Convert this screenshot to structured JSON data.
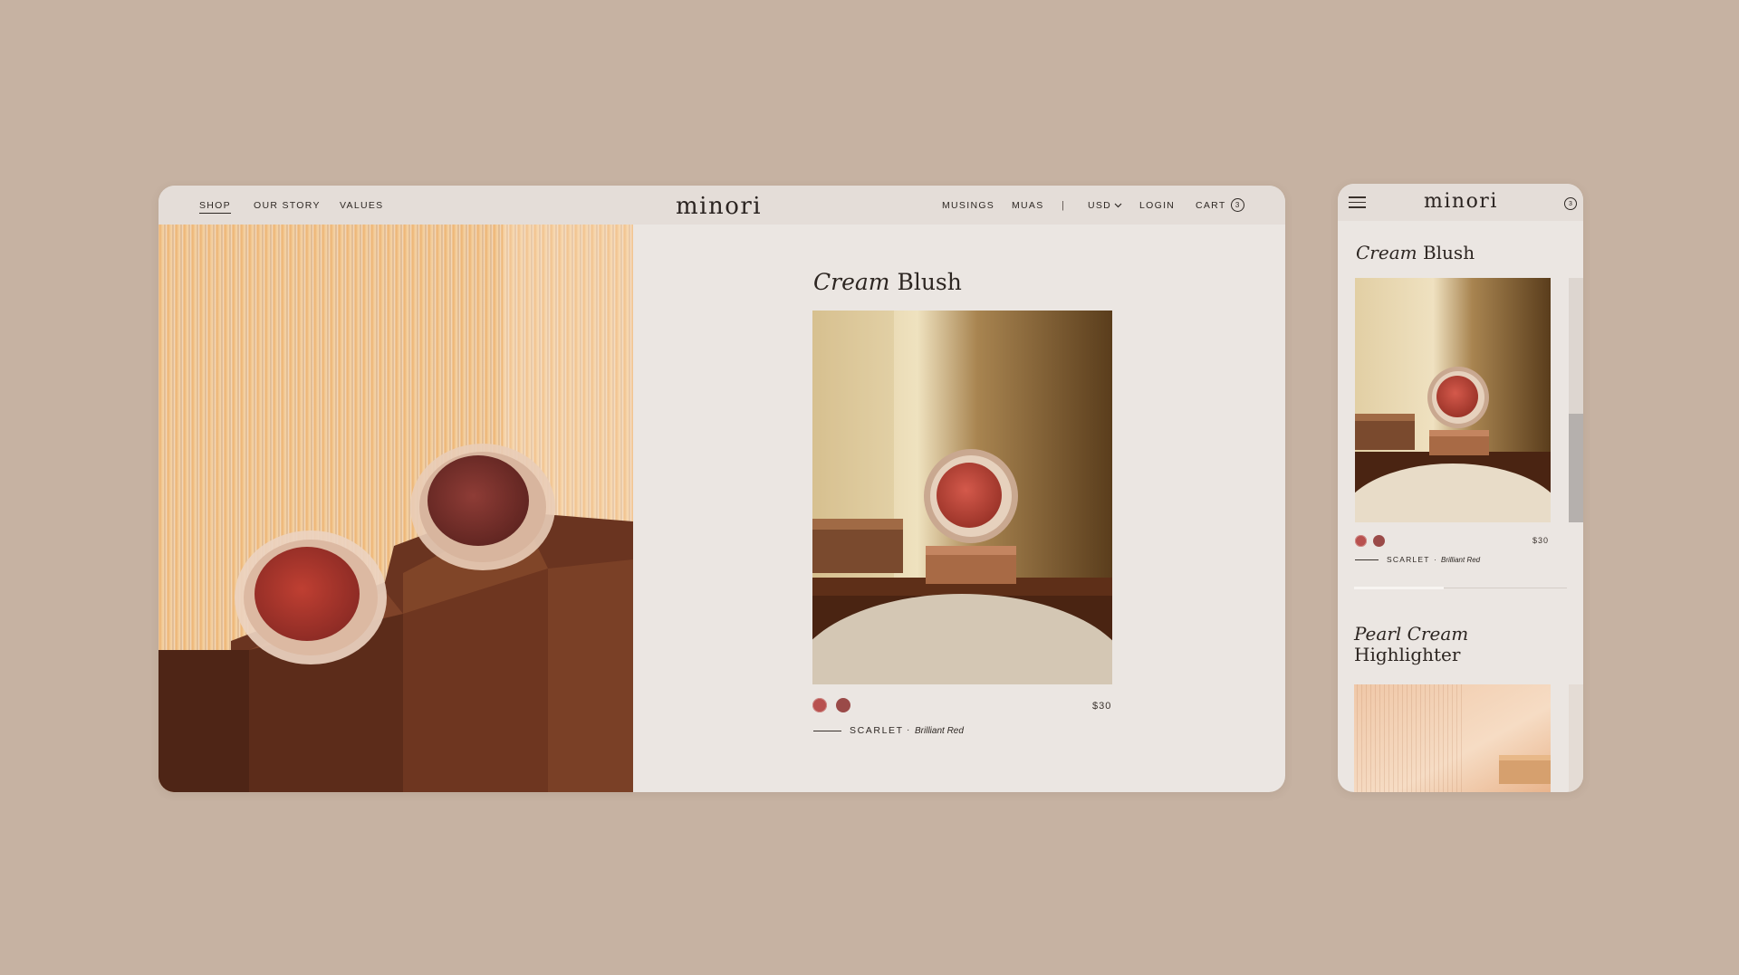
{
  "desktop": {
    "nav": {
      "left_links": [
        "SHOP",
        "OUR STORY",
        "VALUES"
      ],
      "brand": "minori",
      "right_links": [
        "MUSINGS",
        "MUAs"
      ],
      "divider": "|",
      "currency": "USD",
      "login": "LOGIN",
      "cart_label": "CART",
      "cart_count": "3"
    },
    "product": {
      "title_italic": "Cream",
      "title_regular": "Blush",
      "price": "$30",
      "shade_name": "SCARLET",
      "shade_separator": "·",
      "shade_desc": "Brilliant Red",
      "swatch_colors": [
        "#b8514f",
        "#9a4a48"
      ]
    }
  },
  "mobile": {
    "brand": "minori",
    "cart_count": "3",
    "product1": {
      "title_italic": "Cream",
      "title_regular": "Blush",
      "price": "$30",
      "shade_name": "SCARLET",
      "shade_separator": "·",
      "shade_desc": "Brilliant Red",
      "swatch_colors": [
        "#b8514f",
        "#9a4a48"
      ],
      "carousel_progress": 0.42
    },
    "product2": {
      "title_italic": "Pearl Cream",
      "title_regular": "Highlighter"
    }
  },
  "icons": [
    "chevron-down-icon",
    "hamburger-menu-icon",
    "cart-count-icon"
  ],
  "colors": {
    "page_background": "#c6b2a2",
    "panel_background": "#ebe6e2",
    "nav_background": "#e4ddd8",
    "text": "#2e2824"
  }
}
